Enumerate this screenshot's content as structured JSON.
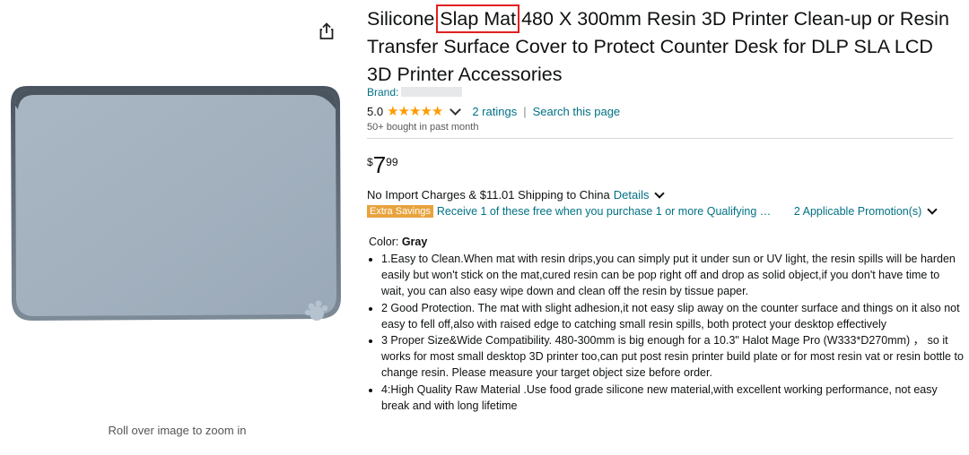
{
  "left": {
    "zoom_hint": "Roll over image to zoom in",
    "share_icon": "share-icon",
    "product_image": "gray-silicone-mat"
  },
  "product": {
    "title_pre": "Silicone ",
    "title_highlight": "Slap Mat",
    "title_post": " 480 X 300mm Resin 3D Printer Clean-up or Resin Transfer Surface Cover to Protect Counter Desk for DLP SLA LCD 3D Printer Accessories",
    "highlight_color": "#e02020",
    "brand_label": "Brand:",
    "rating_value": "5.0",
    "stars": "★★★★★",
    "star_color": "#ff9c00",
    "ratings_count": "2 ratings",
    "search_page": "Search this page",
    "bought": "50+ bought in past month",
    "price_symbol": "$",
    "price_whole": "7",
    "price_fraction": "99",
    "shipping_text": "No Import Charges & $11.01 Shipping to China",
    "details_link": "Details",
    "badge": "Extra Savings",
    "badge_color": "#e8a33d",
    "promo_text": "Receive 1 of these free when you purchase 1 or more Qualifying …",
    "promo_link": "2 Applicable Promotion(s)",
    "color_label": "Color:",
    "color_value": "Gray",
    "bullets": [
      "1.Easy to Clean.When mat with resin drips,you can simply put it under sun or UV light, the resin spills will be harden easily but won't stick on the mat,cured resin can be pop right off and drop as solid object,if you don't have time to wait, you can also easy wipe down and clean off the resin by tissue paper.",
      "2 Good Protection. The mat with slight adhesion,it not easy slip away on the counter surface and things on it also not easy to fell off,also with raised edge to catching small resin spills, both protect your desktop effectively",
      "3 Proper Size&Wide Compatibility. 480-300mm is big enough for a 10.3\" Halot Mage Pro (W333*D270mm) ， so it works for most small desktop 3D printer too,can put post resin printer build plate or for most resin vat or resin bottle to change resin. Please measure your target object size before order.",
      "4:High Quality Raw Material .Use food grade silicone new material,with excellent working performance, not easy break and with long lifetime"
    ]
  }
}
